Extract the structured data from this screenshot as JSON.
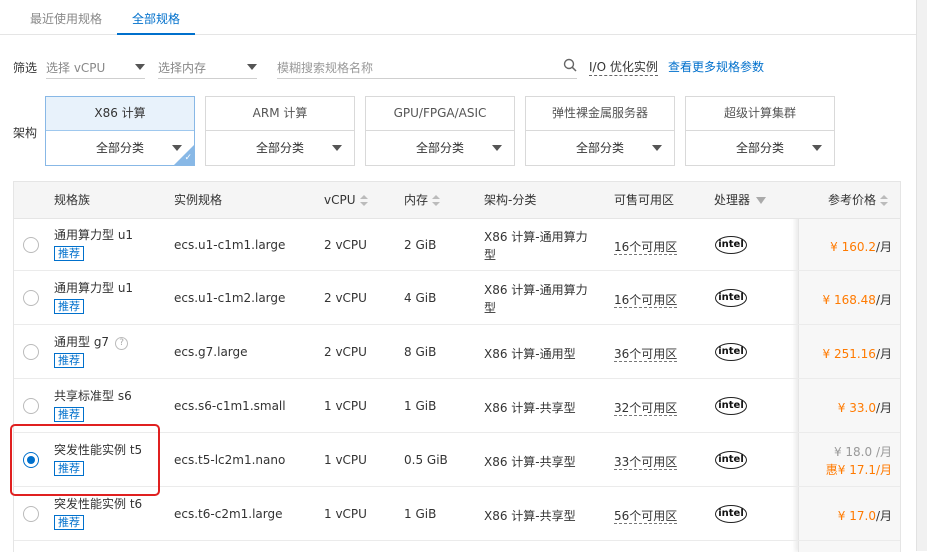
{
  "tabs": {
    "recent": "最近使用规格",
    "all": "全部规格"
  },
  "filter": {
    "label": "筛选",
    "vcpu_placeholder": "选择 vCPU",
    "memory_placeholder": "选择内存",
    "search_placeholder": "模糊搜索规格名称",
    "io_optimized": "I/O 优化实例",
    "more_params": "查看更多规格参数"
  },
  "arch": {
    "label": "架构",
    "options": [
      {
        "name": "X86 计算",
        "category": "全部分类",
        "selected": true
      },
      {
        "name": "ARM 计算",
        "category": "全部分类",
        "selected": false
      },
      {
        "name": "GPU/FPGA/ASIC",
        "category": "全部分类",
        "selected": false
      },
      {
        "name": "弹性裸金属服务器",
        "category": "全部分类",
        "selected": false
      },
      {
        "name": "超级计算集群",
        "category": "全部分类",
        "selected": false
      }
    ]
  },
  "table": {
    "headers": {
      "family": "规格族",
      "instance": "实例规格",
      "vcpu": "vCPU",
      "memory": "内存",
      "arch": "架构-分类",
      "zones": "可售可用区",
      "processor": "处理器",
      "price": "参考价格"
    },
    "recommend_label": "推荐",
    "processor_label": "intel",
    "currency": "¥",
    "per_month": "/月",
    "discount_prefix": "惠",
    "rows": [
      {
        "family": "通用算力型 u1",
        "recommend": true,
        "help": false,
        "instance": "ecs.u1-c1m1.large",
        "vcpu": "2 vCPU",
        "memory": "2 GiB",
        "arch_line1": "X86 计算-通用算力",
        "arch_line2": "型",
        "zones": "16个可用区",
        "price": "160.2",
        "selected": false
      },
      {
        "family": "通用算力型 u1",
        "recommend": true,
        "help": false,
        "instance": "ecs.u1-c1m2.large",
        "vcpu": "2 vCPU",
        "memory": "4 GiB",
        "arch_line1": "X86 计算-通用算力",
        "arch_line2": "型",
        "zones": "16个可用区",
        "price": "168.48",
        "selected": false
      },
      {
        "family": "通用型 g7",
        "recommend": true,
        "help": true,
        "instance": "ecs.g7.large",
        "vcpu": "2 vCPU",
        "memory": "8 GiB",
        "arch_line1": "X86 计算-通用型",
        "arch_line2": "",
        "zones": "36个可用区",
        "price": "251.16",
        "selected": false
      },
      {
        "family": "共享标准型 s6",
        "recommend": true,
        "help": false,
        "instance": "ecs.s6-c1m1.small",
        "vcpu": "1 vCPU",
        "memory": "1 GiB",
        "arch_line1": "X86 计算-共享型",
        "arch_line2": "",
        "zones": "32个可用区",
        "price": "33.0",
        "selected": false
      },
      {
        "family": "突发性能实例 t5",
        "recommend": true,
        "help": false,
        "instance": "ecs.t5-lc2m1.nano",
        "vcpu": "1 vCPU",
        "memory": "0.5 GiB",
        "arch_line1": "X86 计算-共享型",
        "arch_line2": "",
        "zones": "33个可用区",
        "price_old": "18.0",
        "price": "17.1",
        "selected": true
      },
      {
        "family": "突发性能实例 t6",
        "recommend": true,
        "help": false,
        "instance": "ecs.t6-c2m1.large",
        "vcpu": "1 vCPU",
        "memory": "1 GiB",
        "arch_line1": "X86 计算-共享型",
        "arch_line2": "",
        "zones": "56个可用区",
        "price": "17.0",
        "selected": false
      }
    ]
  }
}
